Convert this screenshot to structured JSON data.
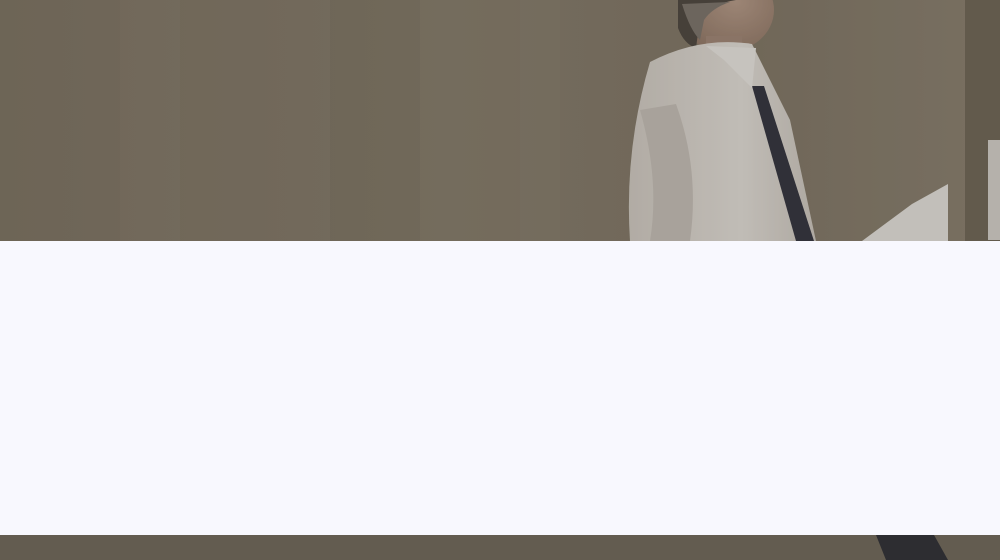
{
  "hero": {
    "image_subject": "businessman-walking"
  },
  "overlay": {
    "dim_color": "#5e5a52",
    "panel_color": "#f8f8fe"
  }
}
